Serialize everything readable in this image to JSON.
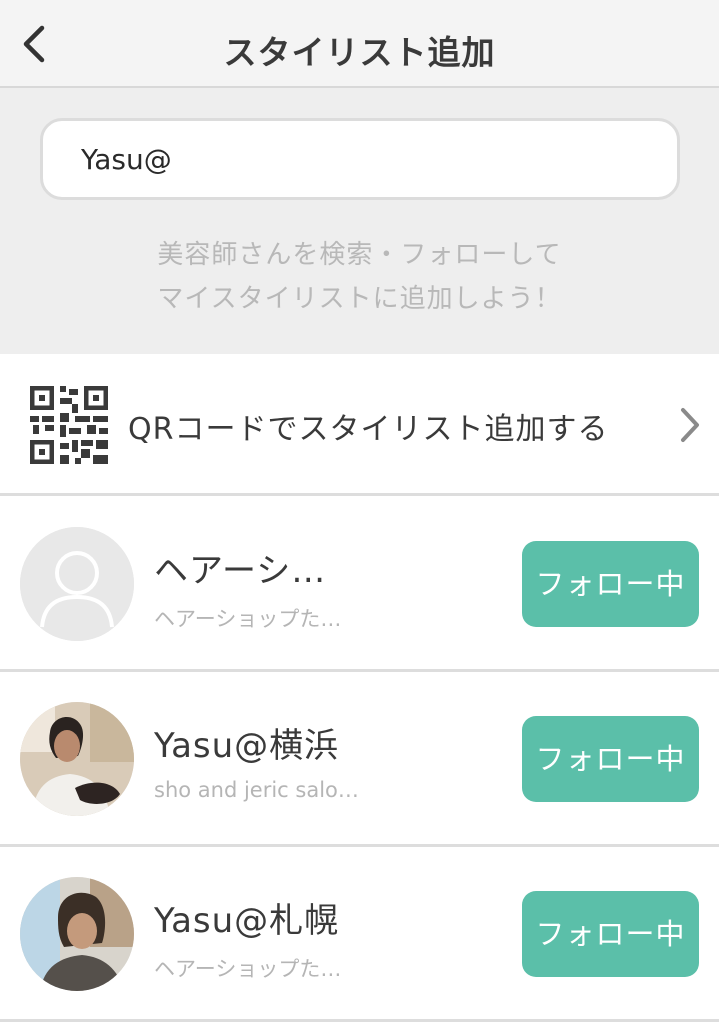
{
  "nav": {
    "title": "スタイリスト追加",
    "back_icon": "chevron-left-icon"
  },
  "search": {
    "value": "Yasu@",
    "hint_line1": "美容師さんを検索・フォローして",
    "hint_line2": "マイスタイリストに追加しよう！"
  },
  "qr_row": {
    "label": "QRコードでスタイリスト追加する",
    "icon": "qr-code-icon",
    "chevron_icon": "chevron-right-icon"
  },
  "results": [
    {
      "name": "ヘアーシ…",
      "salon": "ヘアーショップた…",
      "follow_label": "フォロー中",
      "avatar": "default-avatar-icon"
    },
    {
      "name": "Yasu@横浜",
      "salon": "sho and jeric salo…",
      "follow_label": "フォロー中",
      "avatar": "photo-avatar"
    },
    {
      "name": "Yasu@札幌",
      "salon": "ヘアーショップた…",
      "follow_label": "フォロー中",
      "avatar": "photo-avatar"
    }
  ],
  "colors": {
    "accent": "#5bbfa9",
    "nav_bg": "#f4f4f4",
    "search_bg": "#eeeeee"
  }
}
